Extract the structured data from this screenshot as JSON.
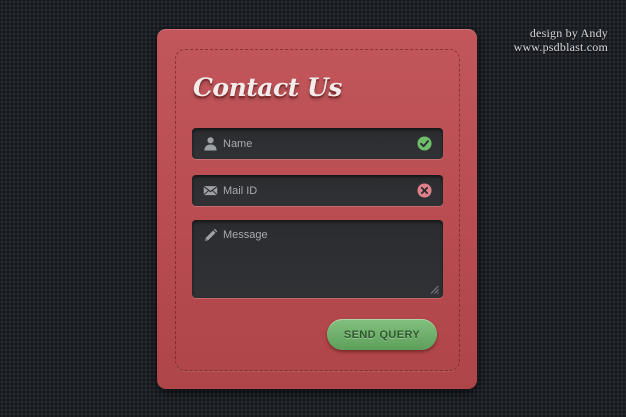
{
  "credit": {
    "line1": "design by Andy",
    "line2": "www.psdblast.com"
  },
  "form": {
    "title": "Contact Us",
    "name_field": {
      "placeholder": "Name",
      "value": "",
      "icon": "user-icon",
      "status": "valid",
      "status_icon": "check-icon"
    },
    "mail_field": {
      "placeholder": "Mail ID",
      "value": "",
      "icon": "envelope-icon",
      "status": "invalid",
      "status_icon": "error-x-icon"
    },
    "message_field": {
      "placeholder": "Message",
      "value": "",
      "icon": "pencil-icon"
    },
    "submit_label": "SEND QUERY"
  },
  "colors": {
    "background": "#1e2228",
    "card": "#b84c50",
    "field": "#2d2f32",
    "button": "#6cad68",
    "valid": "#6fbf6a",
    "invalid": "#e0818a"
  }
}
